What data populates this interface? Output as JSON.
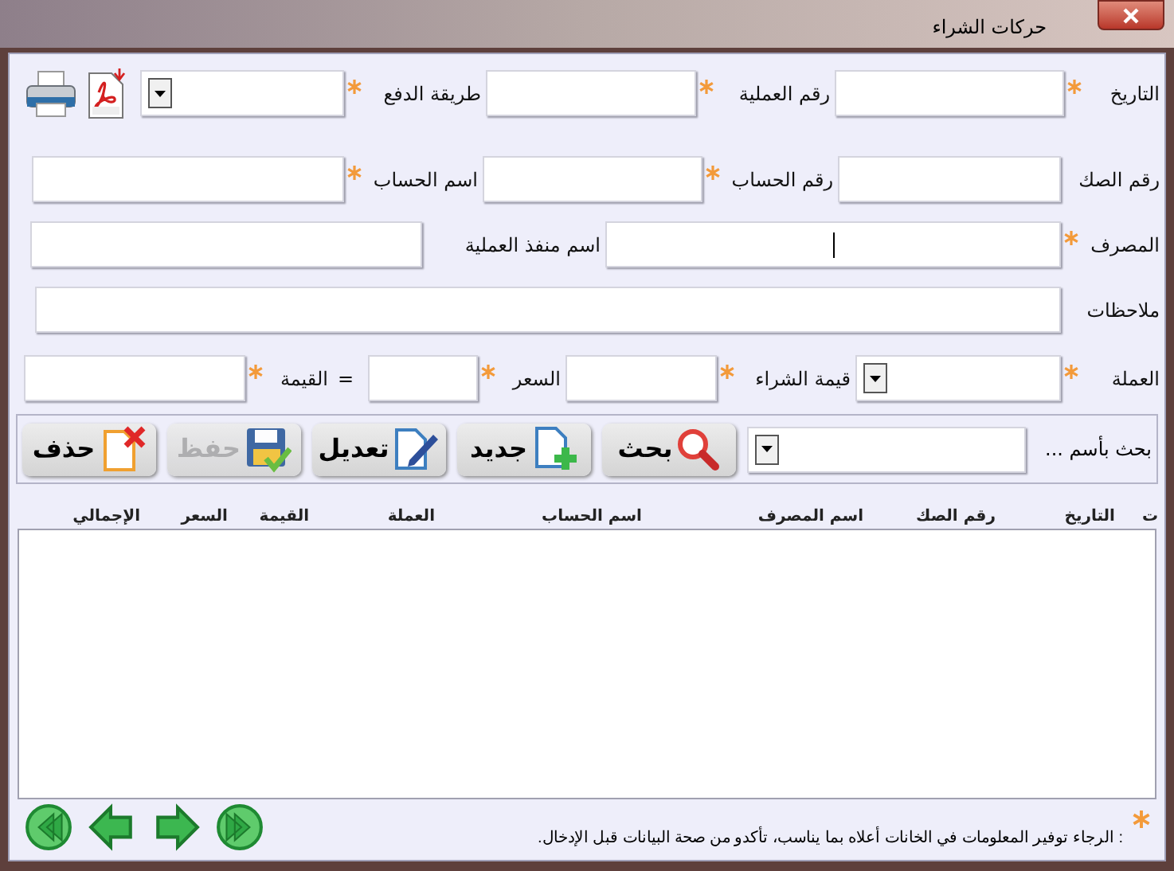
{
  "window": {
    "title": "حركات الشراء"
  },
  "form_rows": [
    [
      {
        "kind": "text",
        "label": "التاريخ",
        "required": true
      },
      {
        "kind": "text",
        "label": "رقم العملية",
        "required": true
      },
      {
        "kind": "combo",
        "label": "طريقة الدفع",
        "required": true
      },
      {
        "kind": "pdf"
      },
      {
        "kind": "print"
      }
    ],
    [
      {
        "kind": "text",
        "label": "رقم الصك",
        "required": false
      },
      {
        "kind": "text",
        "label": "رقم الحساب",
        "required": true
      },
      {
        "kind": "text",
        "label": "اسم الحساب",
        "required": true
      }
    ],
    [
      {
        "kind": "text",
        "label": "المصرف",
        "required": true,
        "focused": true
      },
      {
        "kind": "text",
        "label": "اسم منفذ العملية",
        "required": false
      }
    ],
    [
      {
        "kind": "text",
        "label": "ملاحظات",
        "required": false
      }
    ],
    [
      {
        "kind": "combo",
        "label": "العملة",
        "required": true
      },
      {
        "kind": "text",
        "label": "قيمة الشراء",
        "required": true
      },
      {
        "kind": "text",
        "label": "السعر",
        "required": true
      },
      {
        "kind": "equals",
        "text": "="
      },
      {
        "kind": "text",
        "label": "القيمة",
        "required": true
      }
    ]
  ],
  "toolbar": {
    "search_label": "بحث بأسم ...",
    "buttons": [
      {
        "kind": "search",
        "label": "بحث",
        "disabled": false
      },
      {
        "kind": "new",
        "label": "جديد",
        "disabled": false
      },
      {
        "kind": "edit",
        "label": "تعديل",
        "disabled": false
      },
      {
        "kind": "save",
        "label": "حفظ",
        "disabled": true
      },
      {
        "kind": "delete",
        "label": "حذف",
        "disabled": false
      }
    ]
  },
  "table": {
    "columns": [
      "ت",
      "التاريخ",
      "رقم الصك",
      "اسم المصرف",
      "اسم الحساب",
      "العملة",
      "القيمة",
      "السعر",
      "الإجمالي"
    ]
  },
  "footer": {
    "note": ": الرجاء توفير المعلومات في الخانات أعلاه بما يناسب، تأكدو من صحة البيانات قبل الإدخال."
  }
}
